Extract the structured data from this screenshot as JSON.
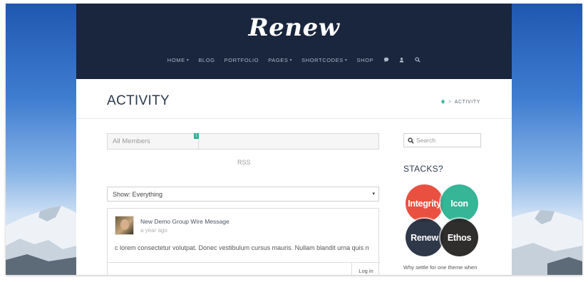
{
  "site": {
    "logo": "Renew"
  },
  "nav": {
    "items": [
      {
        "label": "HOME",
        "dropdown": true
      },
      {
        "label": "BLOG",
        "dropdown": false
      },
      {
        "label": "PORTFOLIO",
        "dropdown": false
      },
      {
        "label": "PAGES",
        "dropdown": true
      },
      {
        "label": "SHORTCODES",
        "dropdown": true
      },
      {
        "label": "SHOP",
        "dropdown": false
      }
    ],
    "caret": "▾",
    "icons": [
      "comment-icon",
      "user-icon",
      "search-icon"
    ]
  },
  "titlebar": {
    "title": "ACTIVITY",
    "breadcrumb": {
      "home_icon": "home-icon",
      "separator": ">",
      "current": "ACTIVITY"
    }
  },
  "main": {
    "members_tab": {
      "label": "All Members",
      "count": "1"
    },
    "rss": "RSS",
    "filter": {
      "selected": "Show: Everything",
      "arrow": "▾"
    },
    "activity": {
      "title": "New Demo Group Wire Message",
      "time": "a year ago",
      "text": "c lorem consectetur volutpat. Donec vestibulum cursus mauris. Nullam blandit urna quis n",
      "login_label": "Log in"
    }
  },
  "sidebar": {
    "search_placeholder": "Search",
    "stacks_heading": "STACKS?",
    "stacks": [
      {
        "label": "Integrity",
        "color": "#e84938"
      },
      {
        "label": "Icon",
        "color": "#29b091"
      },
      {
        "label": "Renew",
        "color": "#253042"
      },
      {
        "label": "Ethos",
        "color": "#282424"
      }
    ],
    "promo_text": "Why settle for one theme when"
  },
  "colors": {
    "header_bg": "#19263d",
    "accent": "#2fb296"
  }
}
